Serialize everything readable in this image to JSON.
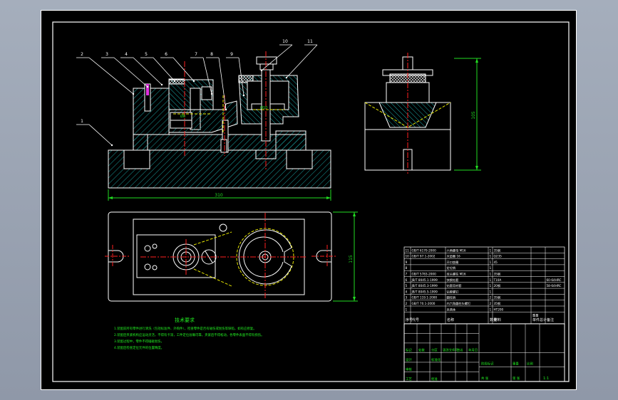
{
  "colors": {
    "viewport_bg": "#9aa3b2",
    "paper": "#000000",
    "line": "#ffffff",
    "hatch": "#1aa6a6",
    "center": "#ff2020",
    "hidden": "#e6e600",
    "dimension": "#22dd22",
    "leader": "#ffffff",
    "table_text": "#ffffff",
    "notes": "#22ee22"
  },
  "front_view": {
    "balloons": [
      "2",
      "3",
      "4",
      "5",
      "6",
      "7",
      "8",
      "9",
      "10",
      "11",
      "1"
    ],
    "overall_dim": "310"
  },
  "side_view": {
    "height_dim": "105"
  },
  "top_view": {
    "width_dim": "115"
  },
  "technical_notes": {
    "title": "技术要求",
    "lines": [
      "1.装配前所有零件进行清洗（包括标准件、外购件），检查零件是否有碰伤或划伤等缺陷，如有应修复。",
      "2.装配后夹紧机构应运动灵活，不得有卡滞，工件定位准确可靠，夹紧后不得松动，各零件表面不得有损伤。",
      "3.装配过程中，零件不得磕碰划伤，",
      "4.装配后检查定位元件的位置精度。"
    ]
  },
  "parts_list": {
    "rows": [
      {
        "no": "11",
        "code": "GB/T 6170-2000",
        "name": "六角螺母 M16",
        "qty": "1",
        "material": "35钢",
        "note": ""
      },
      {
        "no": "10",
        "code": "GB/T 97.1-2002",
        "name": "大垫圈 16",
        "qty": "1",
        "material": "Q235",
        "note": ""
      },
      {
        "no": "9",
        "code": "",
        "name": "开口垫圈",
        "qty": "1",
        "material": "45",
        "note": ""
      },
      {
        "no": "8",
        "code": "",
        "name": "定位销",
        "qty": "1",
        "material": "",
        "note": ""
      },
      {
        "no": "7",
        "code": "GB/T 5783-2000",
        "name": "双头螺柱 M16",
        "qty": "1",
        "material": "35钢",
        "note": ""
      },
      {
        "no": "6",
        "code": "JB/T 8045.1-1999",
        "name": "快换钻套",
        "qty": "1",
        "material": "T10A",
        "note": "60-64HRC"
      },
      {
        "no": "5",
        "code": "JB/T 8045.3-1999",
        "name": "钻套用衬套",
        "qty": "1",
        "material": "20钢",
        "note": "58-64HRC"
      },
      {
        "no": "4",
        "code": "JB/T 8045.5-1999",
        "name": "钻套螺钉",
        "qty": "1",
        "material": "",
        "note": ""
      },
      {
        "no": "3",
        "code": "GB/T 119.1-2000",
        "name": "圆柱销",
        "qty": "2",
        "material": "35钢",
        "note": ""
      },
      {
        "no": "2",
        "code": "GB/T 70.1-2000",
        "name": "内六角圆柱头螺钉",
        "qty": "2",
        "material": "35钢",
        "note": ""
      },
      {
        "no": "1",
        "code": "",
        "name": "夹具体",
        "qty": "1",
        "material": "HT200",
        "note": ""
      }
    ],
    "header": {
      "no": "序号",
      "code": "代号",
      "name": "名称",
      "qty": "数量",
      "material": "材料",
      "unit_weight": "单件",
      "total_weight": "总计",
      "weight": "重量",
      "note": "备注"
    }
  },
  "title_block": {
    "labels": [
      "标记",
      "处数",
      "分区",
      "更改文件号",
      "签名",
      "年月日",
      "设计",
      "标准化",
      "审核",
      "工艺",
      "批准",
      "阶段标记",
      "重量",
      "比例",
      "共 张",
      "第 张"
    ],
    "scale": "1:1"
  }
}
